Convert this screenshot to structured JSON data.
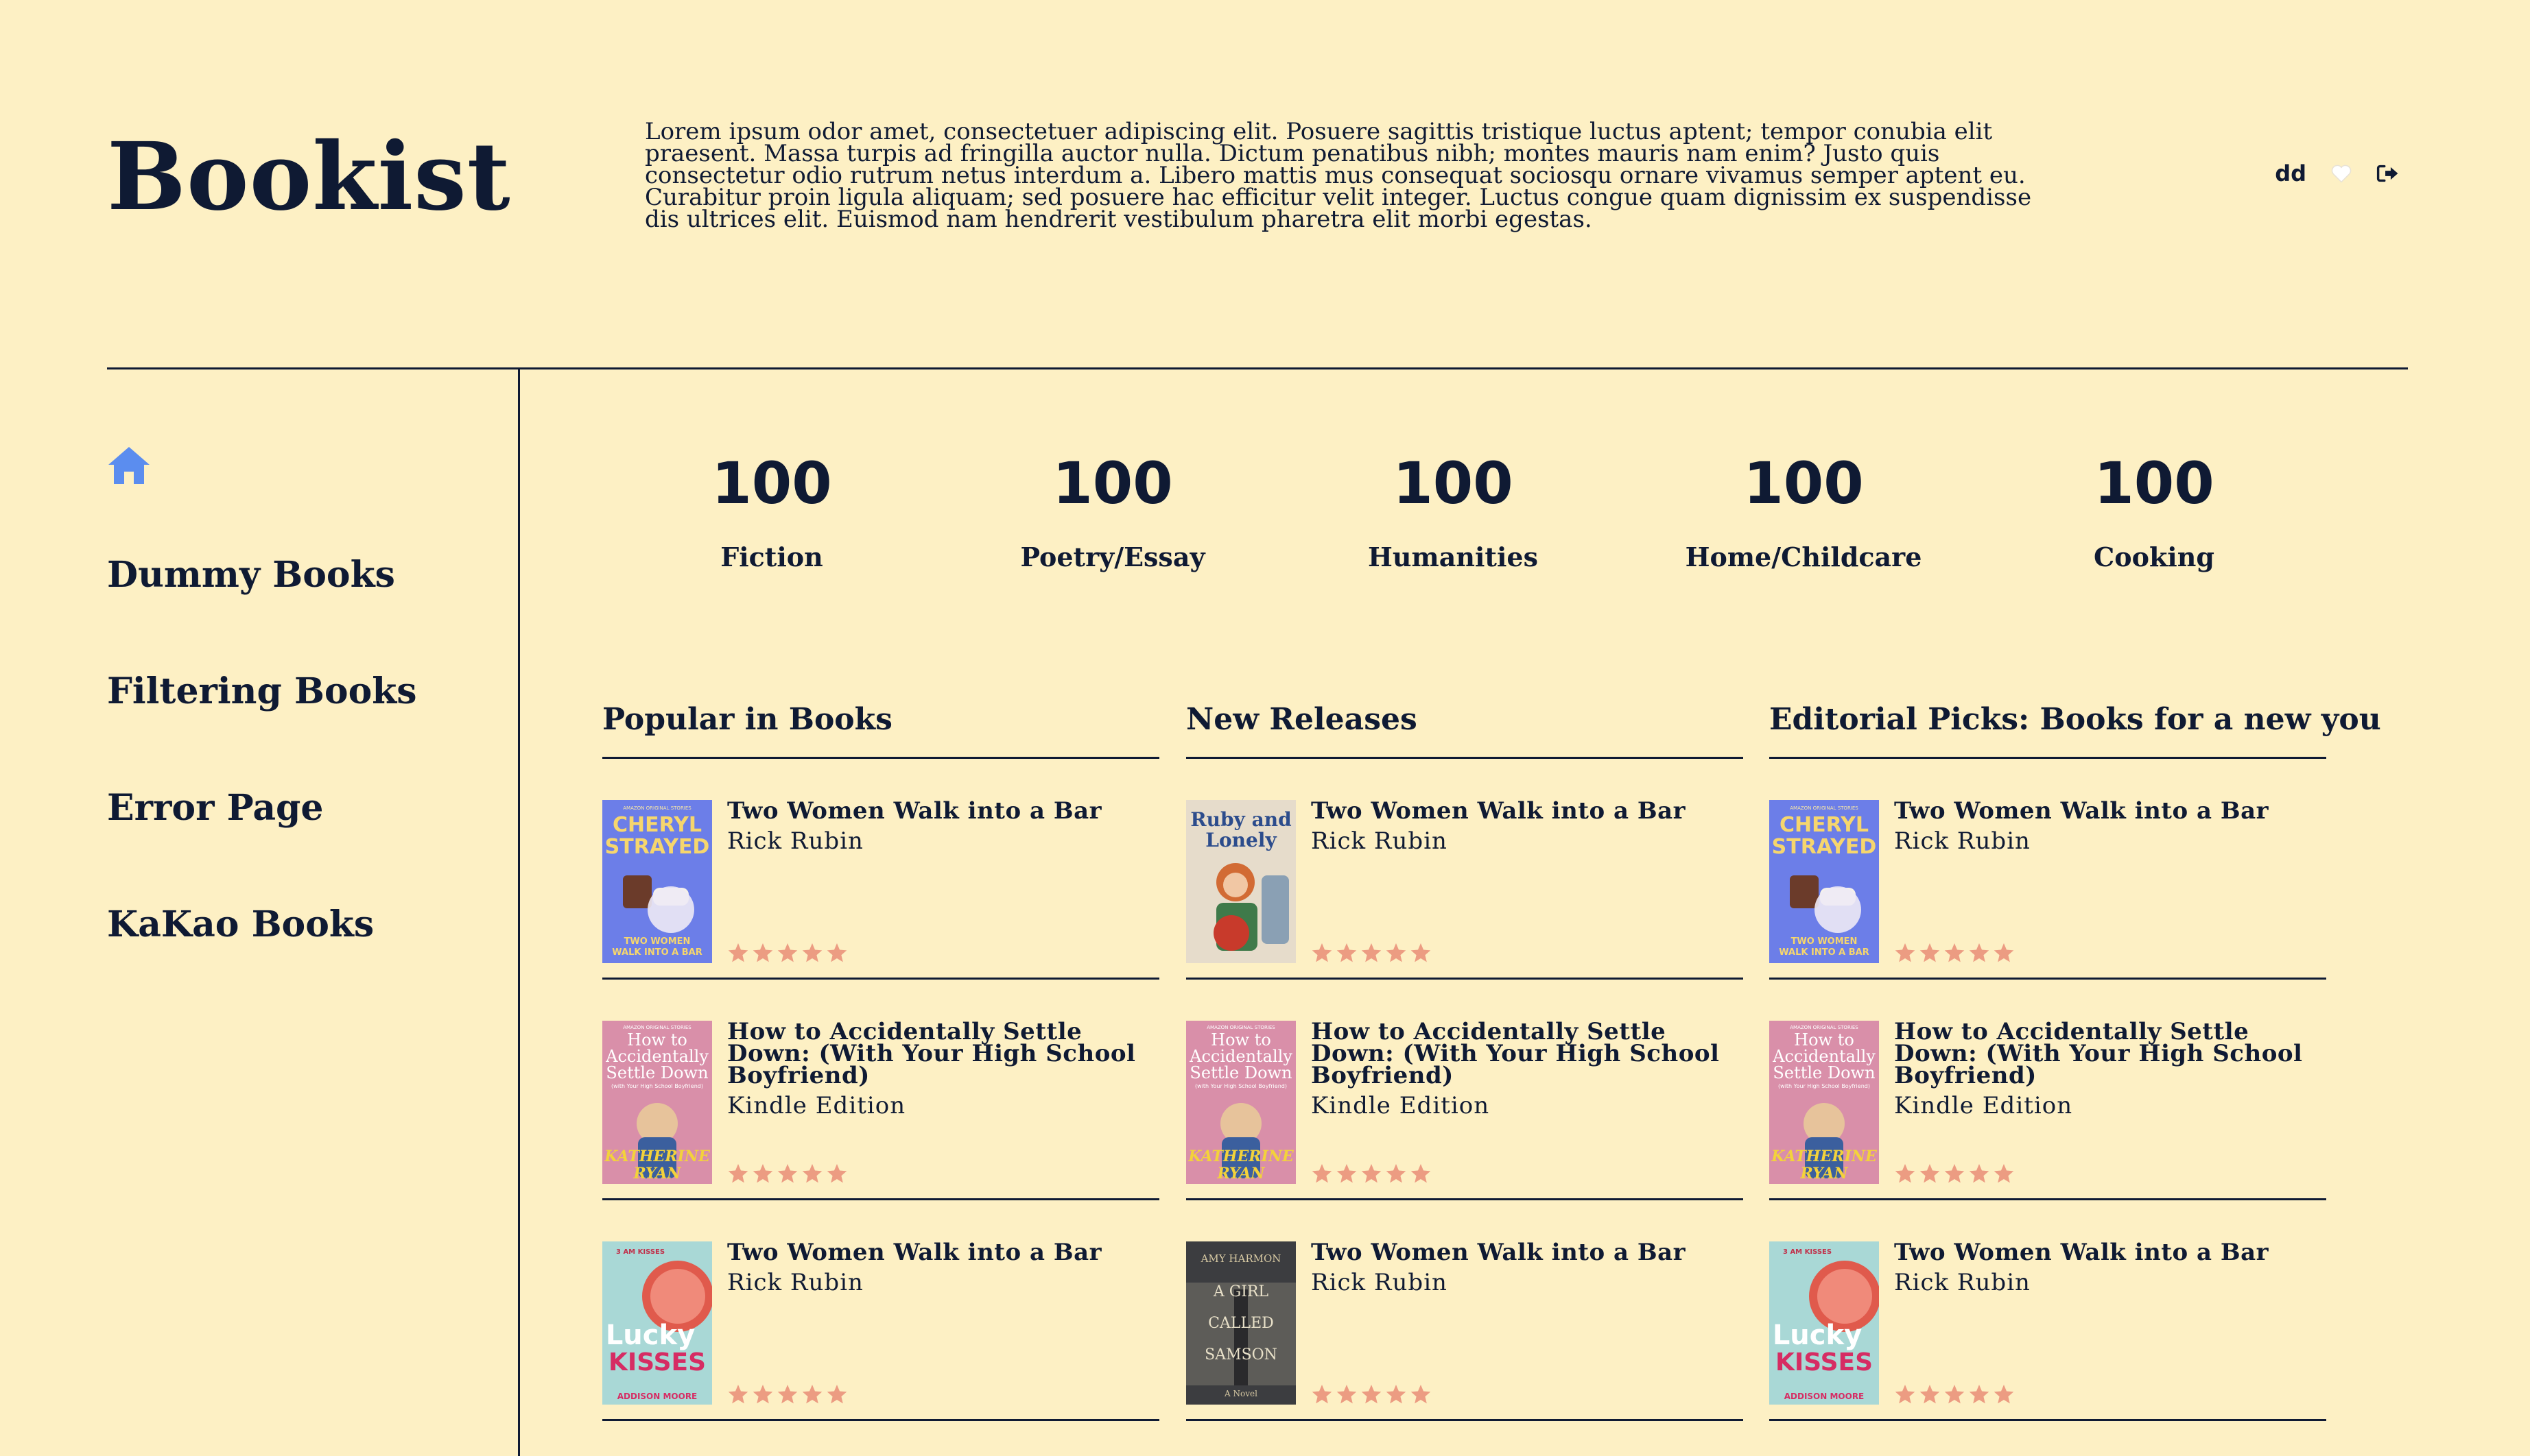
{
  "header": {
    "brand": "Bookist",
    "intro": "Lorem ipsum odor amet, consectetuer adipiscing elit. Posuere sagittis tristique luctus aptent; tempor conubia elit praesent. Massa turpis ad fringilla auctor nulla. Dictum penatibus nibh; montes mauris nam enim? Justo quis consectetur odio rutrum netus interdum a. Libero mattis mus consequat sociosqu ornare vivamus semper aptent eu. Curabitur proin ligula aliquam; sed posuere hac efficitur velit integer. Luctus congue quam dignissim ex suspendisse dis ultrices elit. Euismod nam hendrerit vestibulum pharetra elit morbi egestas.",
    "user_name": "dd",
    "icons": {
      "favorite": "heart-icon",
      "logout": "logout-icon"
    }
  },
  "sidebar": {
    "home_icon": "home-icon",
    "items": [
      {
        "label": "Dummy Books"
      },
      {
        "label": "Filtering Books"
      },
      {
        "label": "Error Page"
      },
      {
        "label": "KaKao Books"
      }
    ]
  },
  "stats": [
    {
      "value": "100",
      "label": "Fiction"
    },
    {
      "value": "100",
      "label": "Poetry/Essay"
    },
    {
      "value": "100",
      "label": "Humanities"
    },
    {
      "value": "100",
      "label": "Home/Childcare"
    },
    {
      "value": "100",
      "label": "Cooking"
    }
  ],
  "columns": [
    {
      "title": "Popular in Books",
      "books": [
        {
          "title": "Two Women Walk into a Bar",
          "author": "Rick Rubin",
          "rating": 5,
          "cover": "cheryl-strayed"
        },
        {
          "title": "How to Accidentally Settle Down: (With Your High School Boyfriend)",
          "author": "Kindle Edition",
          "rating": 5,
          "cover": "katherine-ryan"
        },
        {
          "title": "Two Women Walk into a Bar",
          "author": "Rick Rubin",
          "rating": 5,
          "cover": "lucky-kisses"
        }
      ]
    },
    {
      "title": "New Releases",
      "books": [
        {
          "title": "Two Women Walk into a Bar",
          "author": "Rick Rubin",
          "rating": 5,
          "cover": "ruby-and-lonely"
        },
        {
          "title": "How to Accidentally Settle Down: (With Your High School Boyfriend)",
          "author": "Kindle Edition",
          "rating": 5,
          "cover": "katherine-ryan"
        },
        {
          "title": "Two Women Walk into a Bar",
          "author": "Rick Rubin",
          "rating": 5,
          "cover": "a-girl-called-samson"
        }
      ]
    },
    {
      "title": "Editorial Picks: Books for a new you",
      "books": [
        {
          "title": "Two Women Walk into a Bar",
          "author": "Rick Rubin",
          "rating": 5,
          "cover": "cheryl-strayed"
        },
        {
          "title": "How to Accidentally Settle Down: (With Your High School Boyfriend)",
          "author": "Kindle Edition",
          "rating": 5,
          "cover": "katherine-ryan"
        },
        {
          "title": "Two Women Walk into a Bar",
          "author": "Rick Rubin",
          "rating": 5,
          "cover": "lucky-kisses"
        }
      ]
    }
  ],
  "covers": {
    "cheryl-strayed": {
      "top": "AMAZON ORIGINAL STORIES",
      "line1": "CHERYL",
      "line2": "STRAYED",
      "bottom1": "TWO WOMEN",
      "bottom2": "WALK INTO A BAR",
      "bg": "#6c7ee8"
    },
    "katherine-ryan": {
      "top": "AMAZON ORIGINAL STORIES",
      "line1": "How to",
      "line2": "Accidentally",
      "line3": "Settle Down",
      "sub": "(with Your High School Boyfriend)",
      "author": "KATHERINE RYAN",
      "bg": "#d98fa9"
    },
    "lucky-kisses": {
      "line1": "3 AM KISSES",
      "line2": "Lucky",
      "line3": "KISSES",
      "author": "ADDISON MOORE",
      "bg": "#a9d8d6"
    },
    "ruby-and-lonely": {
      "line1": "Ruby and",
      "line2": "Lonely",
      "bg": "#e6dccb"
    },
    "a-girl-called-samson": {
      "top": "AMY HARMON",
      "line1": "A GIRL",
      "line2": "CALLED",
      "line3": "SAMSON",
      "bottom": "A Novel",
      "bg": "#3c3d40"
    }
  },
  "colors": {
    "background": "#fdf0c4",
    "text": "#0f1a33",
    "accent_home": "#5b8def",
    "star": "#ec9c82"
  }
}
